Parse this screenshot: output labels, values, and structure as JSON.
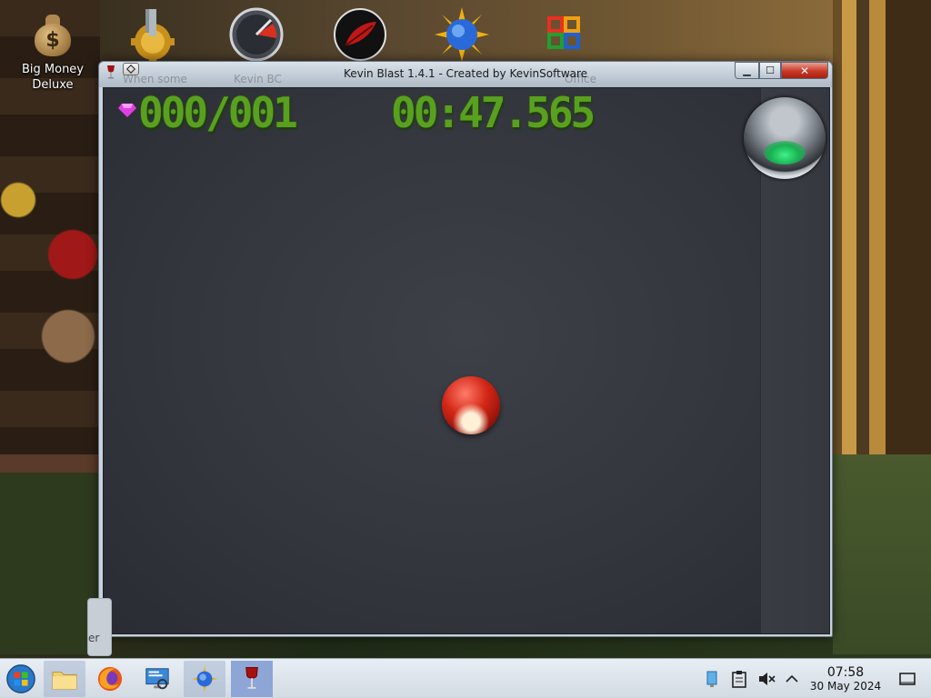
{
  "desktop": {
    "icons": [
      {
        "label": "Big Money\nDeluxe",
        "icon": "money-bag-icon"
      }
    ],
    "top_icons": [
      "gear-tool-icon",
      "speedometer-icon",
      "red-leaf-icon",
      "blue-globe-sun-icon",
      "colorful-squares-icon"
    ]
  },
  "window": {
    "title": "Kevin Blast 1.4.1 - Created by KevinSoftware",
    "ghost_texts": [
      "When some",
      "Kevin BC",
      "Office"
    ],
    "controls": {
      "minimize": "▁",
      "maximize": "☐",
      "close": "✕"
    }
  },
  "game": {
    "score": "000/001",
    "timer": "00:47.565",
    "gem_icon": "pink-gem-icon",
    "status_orb": "green-orb-button",
    "ball": "red-ball"
  },
  "taskbar": {
    "start": "start-orb-icon",
    "pinned": [
      "file-manager-icon",
      "firefox-icon",
      "system-monitor-icon",
      "kevin-blast-icon",
      "wine-icon"
    ],
    "peek_text": "er",
    "tray": [
      "network-icon",
      "clipboard-icon",
      "volume-muted-icon",
      "tray-expand-icon"
    ],
    "clock": {
      "time": "07:58",
      "date": "30 May 2024"
    },
    "show_desktop": "show-desktop-icon"
  },
  "colors": {
    "score_green": "#5aa020",
    "close_red": "#c83828",
    "ball_red": "#d42818",
    "orb_green": "#18b050"
  }
}
